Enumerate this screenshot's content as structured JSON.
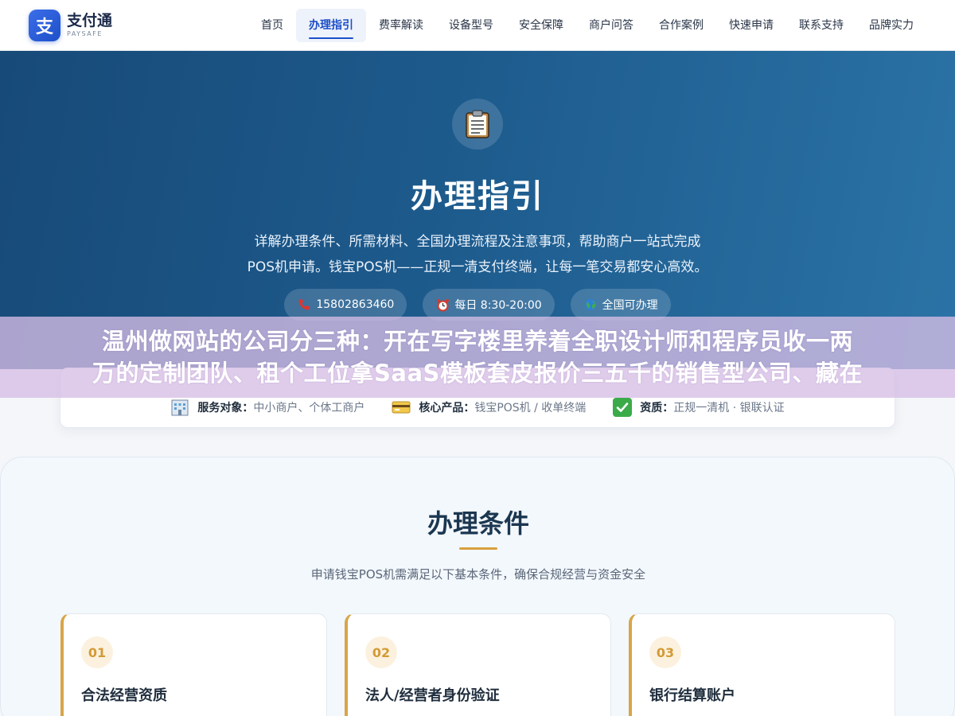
{
  "brand": {
    "logo_char": "支",
    "name": "支付通",
    "subtitle": "PAYSAFE"
  },
  "nav": [
    {
      "label": "首页",
      "active": false
    },
    {
      "label": "办理指引",
      "active": true
    },
    {
      "label": "费率解读",
      "active": false
    },
    {
      "label": "设备型号",
      "active": false
    },
    {
      "label": "安全保障",
      "active": false
    },
    {
      "label": "商户问答",
      "active": false
    },
    {
      "label": "合作案例",
      "active": false
    },
    {
      "label": "快速申请",
      "active": false
    },
    {
      "label": "联系支持",
      "active": false
    },
    {
      "label": "品牌实力",
      "active": false
    }
  ],
  "hero": {
    "icon": "clipboard-icon",
    "title": "办理指引",
    "desc_line1": "详解办理条件、所需材料、全国办理流程及注意事项，帮助商户一站式完成",
    "desc_line2": "POS机申请。钱宝POS机——正规一清支付终端，让每一笔交易都安心高效。",
    "pills": [
      {
        "icon": "phone-icon",
        "text": "15802863460"
      },
      {
        "icon": "alarm-clock-icon",
        "text": "每日 8:30-20:00"
      },
      {
        "icon": "globe-icon",
        "text": "全国可办理"
      }
    ]
  },
  "overlay": {
    "line1": "温州做网站的公司分三种：开在写字楼里养着全职设计师和程序员收一两",
    "line2": "万的定制团队、租个工位拿SaaS模板套皮报价三五千的销售型公司、藏在"
  },
  "info_bar": [
    {
      "icon": "building-icon",
      "label": "服务对象：",
      "value": "中小商户、个体工商户"
    },
    {
      "icon": "card-icon",
      "label": "核心产品：",
      "value": "钱宝POS机 / 收单终端"
    },
    {
      "icon": "check-icon",
      "label": "资质：",
      "value": "正规一清机 · 银联认证"
    }
  ],
  "conditions": {
    "title": "办理条件",
    "subtitle": "申请钱宝POS机需满足以下基本条件，确保合规经营与资金安全",
    "cards": [
      {
        "num": "01",
        "title": "合法经营资质"
      },
      {
        "num": "02",
        "title": "法人/经营者身份验证"
      },
      {
        "num": "03",
        "title": "银行结算账户"
      }
    ]
  },
  "colors": {
    "primary": "#1d4fc9",
    "hero_bg": "#1d5a8c",
    "accent": "#d9a547"
  }
}
